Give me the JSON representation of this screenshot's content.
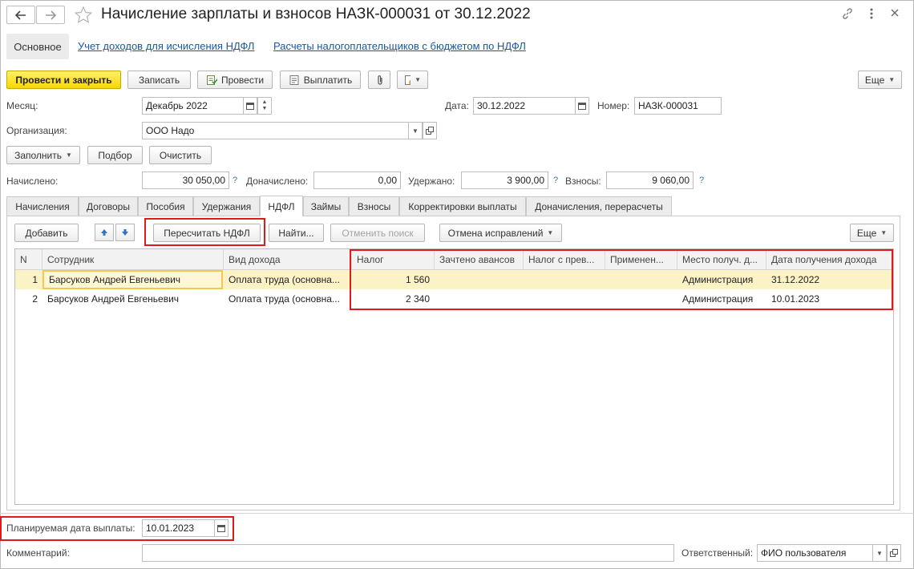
{
  "window": {
    "title": "Начисление зарплаты и взносов НАЗК-000031 от 30.12.2022"
  },
  "nav": {
    "main_tab": "Основное",
    "links": [
      "Учет доходов для исчисления НДФЛ",
      "Расчеты налогоплательщиков с бюджетом по НДФЛ"
    ]
  },
  "toolbar": {
    "post_close": "Провести и закрыть",
    "save": "Записать",
    "post": "Провести",
    "pay": "Выплатить",
    "more": "Еще"
  },
  "form": {
    "month_label": "Месяц:",
    "month_value": "Декабрь 2022",
    "date_label": "Дата:",
    "date_value": "30.12.2022",
    "number_label": "Номер:",
    "number_value": "НАЗК-000031",
    "org_label": "Организация:",
    "org_value": "ООО Надо",
    "fill": "Заполнить",
    "select": "Подбор",
    "clear": "Очистить",
    "accrued_label": "Начислено:",
    "accrued_value": "30 050,00",
    "additional_label": "Доначислено:",
    "additional_value": "0,00",
    "withheld_label": "Удержано:",
    "withheld_value": "3 900,00",
    "contrib_label": "Взносы:",
    "contrib_value": "9 060,00",
    "help": "?"
  },
  "tabs": [
    "Начисления",
    "Договоры",
    "Пособия",
    "Удержания",
    "НДФЛ",
    "Займы",
    "Взносы",
    "Корректировки выплаты",
    "Доначисления, перерасчеты"
  ],
  "active_tab": "НДФЛ",
  "tab_toolbar": {
    "add": "Добавить",
    "recalc": "Пересчитать НДФЛ",
    "find": "Найти...",
    "cancel_search": "Отменить поиск",
    "cancel_corrections": "Отмена исправлений",
    "more": "Еще"
  },
  "table": {
    "columns": [
      "N",
      "Сотрудник",
      "Вид дохода",
      "Налог",
      "Зачтено авансов",
      "Налог с прев...",
      "Применен...",
      "Место получ. д...",
      "Дата получения дохода"
    ],
    "rows": [
      [
        "1",
        "Барсуков Андрей Евгеньевич",
        "Оплата труда (основна...",
        "1 560",
        "",
        "",
        "",
        "Администрация",
        "31.12.2022"
      ],
      [
        "2",
        "Барсуков Андрей Евгеньевич",
        "Оплата труда (основна...",
        "2 340",
        "",
        "",
        "",
        "Администрация",
        "10.01.2023"
      ]
    ]
  },
  "footer": {
    "planned_date_label": "Планируемая дата выплаты:",
    "planned_date_value": "10.01.2023",
    "comment_label": "Комментарий:",
    "comment_value": "",
    "responsible_label": "Ответственный:",
    "responsible_value": "ФИО пользователя"
  },
  "colors": {
    "primary_button": "#f5d800",
    "highlight_box": "#e0191b",
    "selected_row": "#fbf2c6",
    "link": "#1b56a5"
  }
}
